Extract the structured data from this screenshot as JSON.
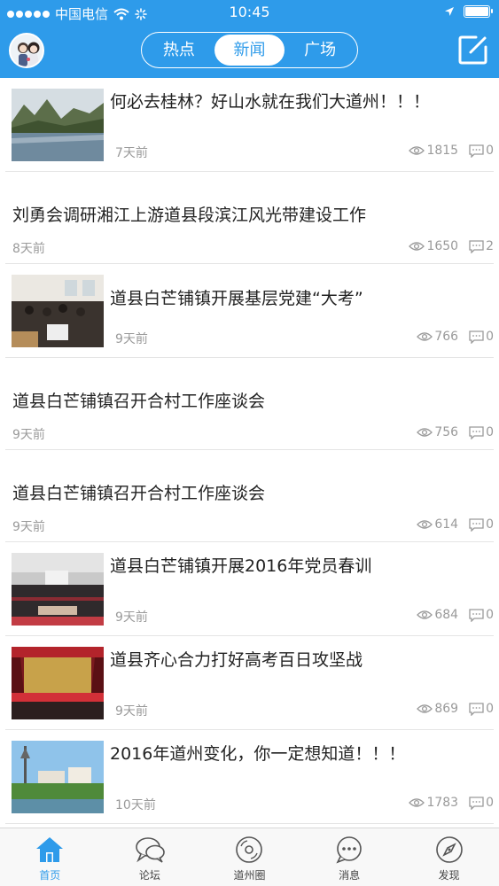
{
  "status_bar": {
    "carrier": "中国电信",
    "time": "10:45"
  },
  "segment": {
    "tabs": [
      "热点",
      "新闻",
      "广场"
    ],
    "active_index": 1
  },
  "colors": {
    "primary": "#2e9bea",
    "meta": "#9a9a9a"
  },
  "news": [
    {
      "title": "何必去桂林？好山水就在我们大道州！！！",
      "time": "7天前",
      "views": "1815",
      "comments": "0",
      "thumb": "landscape"
    },
    {
      "title": "刘勇会调研湘江上游道县段滨江风光带建设工作",
      "time": "8天前",
      "views": "1650",
      "comments": "2",
      "thumb": ""
    },
    {
      "title": "道县白芒铺镇开展基层党建“大考”",
      "time": "9天前",
      "views": "766",
      "comments": "0",
      "thumb": "classroom"
    },
    {
      "title": "道县白芒铺镇召开合村工作座谈会",
      "time": "9天前",
      "views": "756",
      "comments": "0",
      "thumb": ""
    },
    {
      "title": "道县白芒铺镇召开合村工作座谈会",
      "time": "9天前",
      "views": "614",
      "comments": "0",
      "thumb": ""
    },
    {
      "title": "道县白芒铺镇开展2016年党员春训",
      "time": "9天前",
      "views": "684",
      "comments": "0",
      "thumb": "hall"
    },
    {
      "title": "道县齐心合力打好高考百日攻坚战",
      "time": "9天前",
      "views": "869",
      "comments": "0",
      "thumb": "stage"
    },
    {
      "title": "2016年道州变化，你一定想知道！！！",
      "time": "10天前",
      "views": "1783",
      "comments": "0",
      "thumb": "city"
    }
  ],
  "tabbar": [
    {
      "label": "首页",
      "icon": "home-icon",
      "active": true
    },
    {
      "label": "论坛",
      "icon": "forum-chat-icon",
      "active": false
    },
    {
      "label": "道州圈",
      "icon": "circle-disc-icon",
      "active": false
    },
    {
      "label": "消息",
      "icon": "message-bubble-icon",
      "active": false
    },
    {
      "label": "发现",
      "icon": "compass-icon",
      "active": false
    }
  ]
}
